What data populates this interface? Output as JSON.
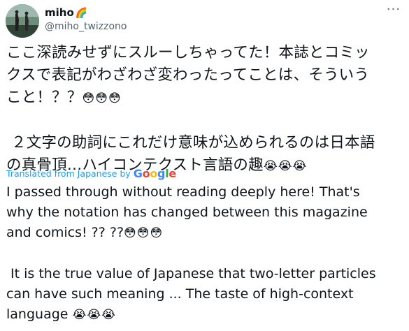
{
  "author": {
    "display_name": "miho",
    "name_emoji": "🌈",
    "handle": "@miho_twizzono",
    "avatar": "avatar-photo"
  },
  "menu": {
    "more_icon": "more-dots-icon",
    "more_label": "···"
  },
  "original": {
    "line1": "ここ深読みせずにスルーしちゃってた！本誌とコミッ",
    "line2": "クスで表記がわざわざ変わったってことは、そういう",
    "line3": "こと！？？",
    "emoji1": "😳😳😳",
    "line5": " ２文字の助詞にこれだけ意味が込められるのは日本語",
    "line6": "の真骨頂…ハイコンテクスト言語の趣",
    "emoji2": "😭😭😭"
  },
  "translation": {
    "label": "Translated from Japanese by",
    "provider": "Google",
    "line1": "I passed through without reading deeply here! That's",
    "line2": "why the notation has changed between this magazine",
    "line3": "and comics! ?? ??",
    "emoji1": "😳😳😳",
    "line5": " It is the true value of Japanese that two-letter particles",
    "line6": "can have such meaning ... The taste of high-context",
    "line7": "language ",
    "emoji2": "😭😭😭"
  },
  "colors": {
    "link": "#1d9bf0",
    "secondary": "#536471",
    "text": "#0f1419"
  }
}
